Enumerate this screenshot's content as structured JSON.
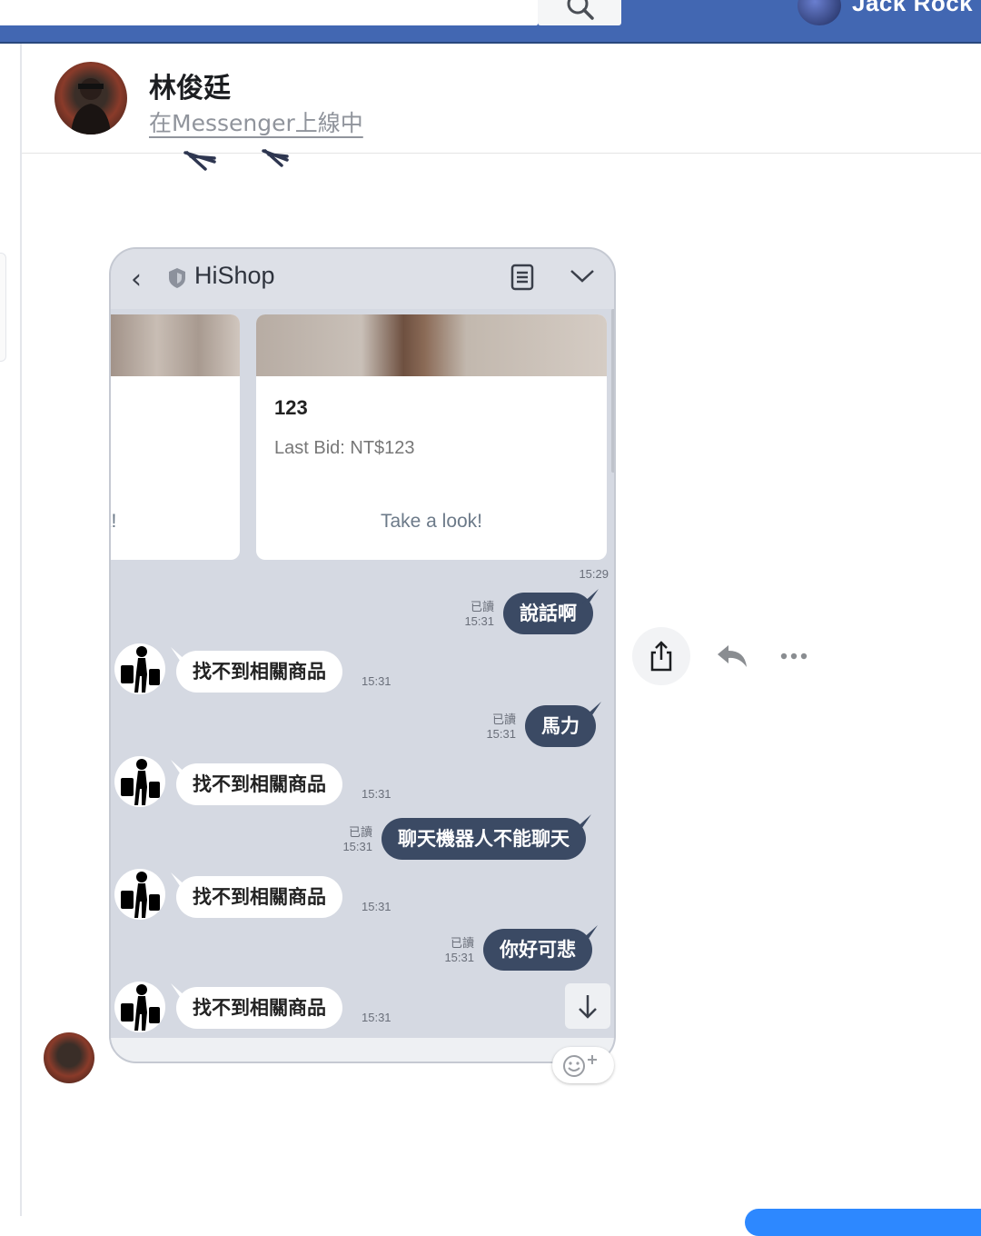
{
  "topbar": {
    "user_name": "Jack Rock"
  },
  "conversation": {
    "contact_name": "林俊廷",
    "contact_status": "在Messenger上線中"
  },
  "shared_image": {
    "app_title": "HiShop",
    "cards": [
      {
        "title": "",
        "subtitle": "",
        "link": "k!"
      },
      {
        "title": "123",
        "subtitle": "Last Bid: NT$123",
        "link": "Take a look!"
      }
    ],
    "card_time": "15:29",
    "messages": [
      {
        "dir": "out",
        "read": "已讀",
        "time": "15:31",
        "text": "說話啊"
      },
      {
        "dir": "in",
        "time": "15:31",
        "text": "找不到相關商品"
      },
      {
        "dir": "out",
        "read": "已讀",
        "time": "15:31",
        "text": "馬力"
      },
      {
        "dir": "in",
        "time": "15:31",
        "text": "找不到相關商品"
      },
      {
        "dir": "out",
        "read": "已讀",
        "time": "15:31",
        "text": "聊天機器人不能聊天"
      },
      {
        "dir": "in",
        "time": "15:31",
        "text": "找不到相關商品"
      },
      {
        "dir": "out",
        "read": "已讀",
        "time": "15:31",
        "text": "你好可悲"
      },
      {
        "dir": "in",
        "time": "15:31",
        "text": "找不到相關商品"
      }
    ]
  },
  "icons": {
    "search": "search-icon",
    "share": "share-icon",
    "reply": "reply-icon",
    "more": "more-icon",
    "emoji": "emoji-add-icon"
  },
  "colors": {
    "topbar": "#4267b2",
    "bubble_out": "#3b4a64",
    "phone_bg": "#d5d9e2"
  }
}
